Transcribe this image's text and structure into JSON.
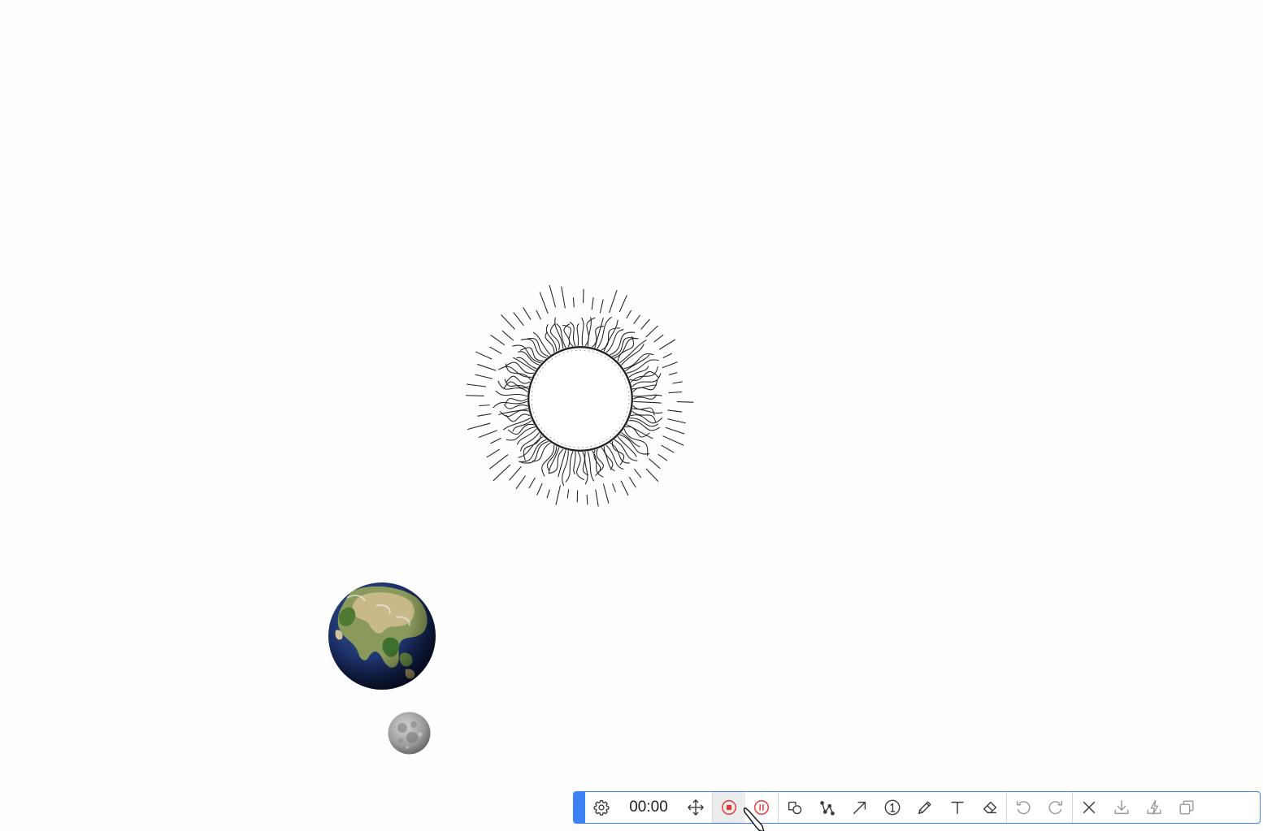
{
  "canvas": {
    "objects": [
      {
        "name": "sun",
        "icon": "sun-sketch"
      },
      {
        "name": "earth",
        "icon": "earth-globe"
      },
      {
        "name": "moon",
        "icon": "moon"
      }
    ]
  },
  "toolbar": {
    "accent_color": "#3b82f6",
    "record_color": "#e53935",
    "timer": "00:00",
    "groups": [
      [
        "settings",
        "timer",
        "move"
      ],
      [
        "record",
        "pause"
      ],
      [
        "shape",
        "curve",
        "arrow",
        "number",
        "pen",
        "text",
        "eraser"
      ],
      [
        "undo",
        "redo"
      ],
      [
        "close",
        "download",
        "flash",
        "copy"
      ]
    ]
  }
}
